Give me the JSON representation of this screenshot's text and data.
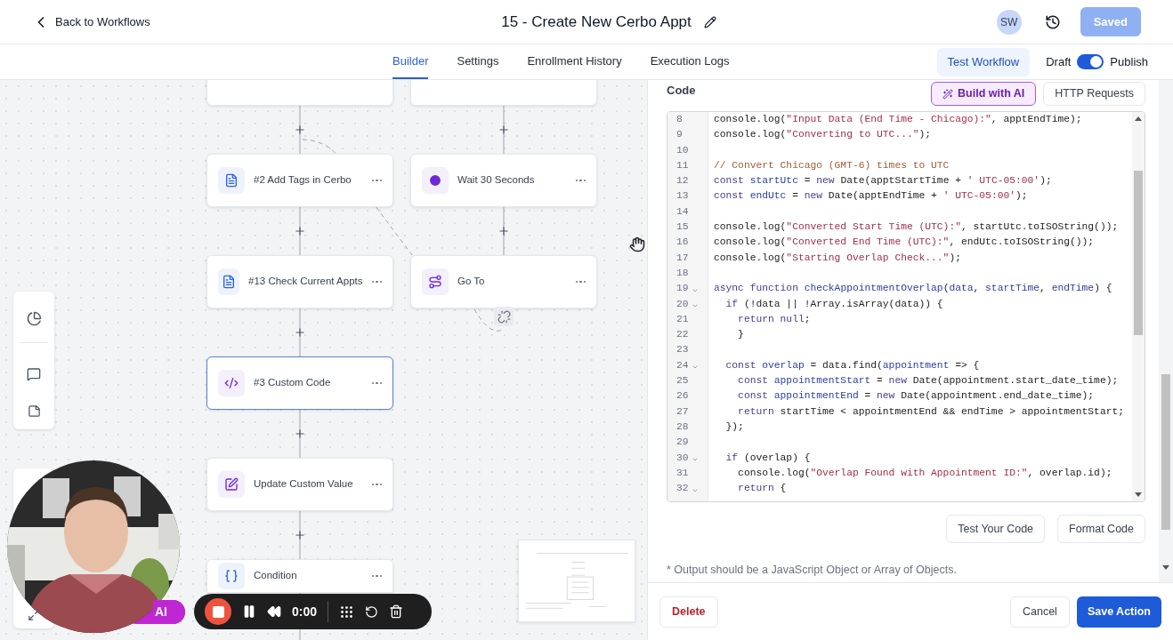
{
  "header": {
    "back_link": "Back to Workflows",
    "title": "15 - Create New Cerbo Appt",
    "avatar": "SW",
    "save_button": {
      "label": "Saved",
      "disabled": true
    }
  },
  "tabs": [
    {
      "label": "Builder",
      "selected": true
    },
    {
      "label": "Settings",
      "selected": false
    },
    {
      "label": "Enrollment History",
      "selected": false
    },
    {
      "label": "Execution Logs",
      "selected": false
    }
  ],
  "test_button": "Test Workflow",
  "publish_toggle": {
    "off_label": "Draft",
    "on_label": "Publish",
    "on": true
  },
  "canvas": {
    "nodes": [
      {
        "label": "#2 Add Tags in Cerbo",
        "selected": false
      },
      {
        "label": "Wait 30 Seconds",
        "selected": false
      },
      {
        "label": "#13 Check Current Appts",
        "selected": false
      },
      {
        "label": "Go To",
        "selected": false
      },
      {
        "label": "#3 Custom Code",
        "selected": true
      },
      {
        "label": "Update Custom Value",
        "selected": false
      },
      {
        "label": "Condition",
        "selected": false
      }
    ],
    "ai_button": "AI",
    "recorder": {
      "time": "0:00",
      "recording": true
    }
  },
  "panel": {
    "section_label": "Code",
    "build_ai_button": "Build with AI",
    "http_button": "HTTP Requests",
    "code_lines": [
      {
        "number": "8",
        "fold": false,
        "tokens": [
          {
            "kind": "plain",
            "text": "console.log("
          },
          {
            "kind": "string",
            "text": "\"Input Data (End Time - Chicago):\""
          },
          {
            "kind": "plain",
            "text": ", apptEndTime);"
          }
        ]
      },
      {
        "number": "9",
        "fold": false,
        "tokens": [
          {
            "kind": "plain",
            "text": "console.log("
          },
          {
            "kind": "string",
            "text": "\"Converting to UTC...\""
          },
          {
            "kind": "plain",
            "text": ");"
          }
        ]
      },
      {
        "number": "10",
        "fold": false
      },
      {
        "number": "11",
        "fold": false,
        "tokens": [
          {
            "kind": "comment",
            "text": "// Convert Chicago (GMT-6) times to UTC"
          }
        ]
      },
      {
        "number": "12",
        "fold": false,
        "tokens": [
          {
            "kind": "keyword",
            "text": "const"
          },
          {
            "kind": "def",
            "text": " startUtc"
          },
          {
            "kind": "plain",
            "text": " = "
          },
          {
            "kind": "keyword",
            "text": "new"
          },
          {
            "kind": "plain",
            "text": " Date(apptStartTime + "
          },
          {
            "kind": "string",
            "text": "' UTC-05:00'"
          },
          {
            "kind": "plain",
            "text": ");"
          }
        ]
      },
      {
        "number": "13",
        "fold": false,
        "tokens": [
          {
            "kind": "keyword",
            "text": "const"
          },
          {
            "kind": "def",
            "text": " endUtc"
          },
          {
            "kind": "plain",
            "text": " = "
          },
          {
            "kind": "keyword",
            "text": "new"
          },
          {
            "kind": "plain",
            "text": " Date(apptEndTime + "
          },
          {
            "kind": "string",
            "text": "' UTC-05:00'"
          },
          {
            "kind": "plain",
            "text": ");"
          }
        ]
      },
      {
        "number": "14",
        "fold": false
      },
      {
        "number": "15",
        "fold": false,
        "tokens": [
          {
            "kind": "plain",
            "text": "console.log("
          },
          {
            "kind": "string",
            "text": "\"Converted Start Time (UTC):\""
          },
          {
            "kind": "plain",
            "text": ", startUtc.toISOString());"
          }
        ]
      },
      {
        "number": "16",
        "fold": false,
        "tokens": [
          {
            "kind": "plain",
            "text": "console.log("
          },
          {
            "kind": "string",
            "text": "\"Converted End Time (UTC):\""
          },
          {
            "kind": "plain",
            "text": ", endUtc.toISOString());"
          }
        ]
      },
      {
        "number": "17",
        "fold": false,
        "tokens": [
          {
            "kind": "plain",
            "text": "console.log("
          },
          {
            "kind": "string",
            "text": "\"Starting Overlap Check...\""
          },
          {
            "kind": "plain",
            "text": ");"
          }
        ]
      },
      {
        "number": "18",
        "fold": false
      },
      {
        "number": "19",
        "fold": true,
        "tokens": [
          {
            "kind": "keyword",
            "text": "async function"
          },
          {
            "kind": "def",
            "text": " checkAppointmentOverlap"
          },
          {
            "kind": "plain",
            "text": "("
          },
          {
            "kind": "def",
            "text": "data"
          },
          {
            "kind": "plain",
            "text": ", "
          },
          {
            "kind": "def",
            "text": "startTime"
          },
          {
            "kind": "plain",
            "text": ", "
          },
          {
            "kind": "def",
            "text": "endTime"
          },
          {
            "kind": "plain",
            "text": ") {"
          }
        ]
      },
      {
        "number": "20",
        "fold": true,
        "tokens": [
          {
            "kind": "keyword",
            "text": "  if"
          },
          {
            "kind": "plain",
            "text": " (!data || !Array.isArray(data)) {"
          }
        ]
      },
      {
        "number": "21",
        "fold": false,
        "tokens": [
          {
            "kind": "keyword",
            "text": "    return null"
          },
          {
            "kind": "plain",
            "text": ";"
          }
        ]
      },
      {
        "number": "22",
        "fold": false,
        "tokens": [
          {
            "kind": "plain",
            "text": "    }"
          }
        ]
      },
      {
        "number": "23",
        "fold": false
      },
      {
        "number": "24",
        "fold": true,
        "tokens": [
          {
            "kind": "keyword",
            "text": "  const"
          },
          {
            "kind": "def",
            "text": " overlap"
          },
          {
            "kind": "plain",
            "text": " = data.find("
          },
          {
            "kind": "def",
            "text": "appointment"
          },
          {
            "kind": "plain",
            "text": " => {"
          }
        ]
      },
      {
        "number": "25",
        "fold": false,
        "tokens": [
          {
            "kind": "keyword",
            "text": "    const"
          },
          {
            "kind": "def",
            "text": " appointmentStart"
          },
          {
            "kind": "plain",
            "text": " = "
          },
          {
            "kind": "keyword",
            "text": "new"
          },
          {
            "kind": "plain",
            "text": " Date(appointment.start_date_time);"
          }
        ]
      },
      {
        "number": "26",
        "fold": false,
        "tokens": [
          {
            "kind": "keyword",
            "text": "    const"
          },
          {
            "kind": "def",
            "text": " appointmentEnd"
          },
          {
            "kind": "plain",
            "text": " = "
          },
          {
            "kind": "keyword",
            "text": "new"
          },
          {
            "kind": "plain",
            "text": " Date(appointment.end_date_time);"
          }
        ]
      },
      {
        "number": "27",
        "fold": false,
        "tokens": [
          {
            "kind": "keyword",
            "text": "    return"
          },
          {
            "kind": "plain",
            "text": " startTime < appointmentEnd && endTime > appointmentStart;"
          }
        ]
      },
      {
        "number": "28",
        "fold": false,
        "tokens": [
          {
            "kind": "plain",
            "text": "  });"
          }
        ]
      },
      {
        "number": "29",
        "fold": false
      },
      {
        "number": "30",
        "fold": true,
        "tokens": [
          {
            "kind": "keyword",
            "text": "  if"
          },
          {
            "kind": "plain",
            "text": " (overlap) {"
          }
        ]
      },
      {
        "number": "31",
        "fold": false,
        "tokens": [
          {
            "kind": "plain",
            "text": "    console.log("
          },
          {
            "kind": "string",
            "text": "\"Overlap Found with Appointment ID:\""
          },
          {
            "kind": "plain",
            "text": ", overlap.id);"
          }
        ]
      },
      {
        "number": "32",
        "fold": true,
        "tokens": [
          {
            "kind": "keyword",
            "text": "    return"
          },
          {
            "kind": "plain",
            "text": " {"
          }
        ]
      }
    ],
    "test_code_button": "Test Your Code",
    "format_button": "Format Code",
    "note": "* Output should be a JavaScript Object or Array of Objects.",
    "delete_button": "Delete",
    "cancel_button": "Cancel",
    "save_button": "Save Action"
  }
}
